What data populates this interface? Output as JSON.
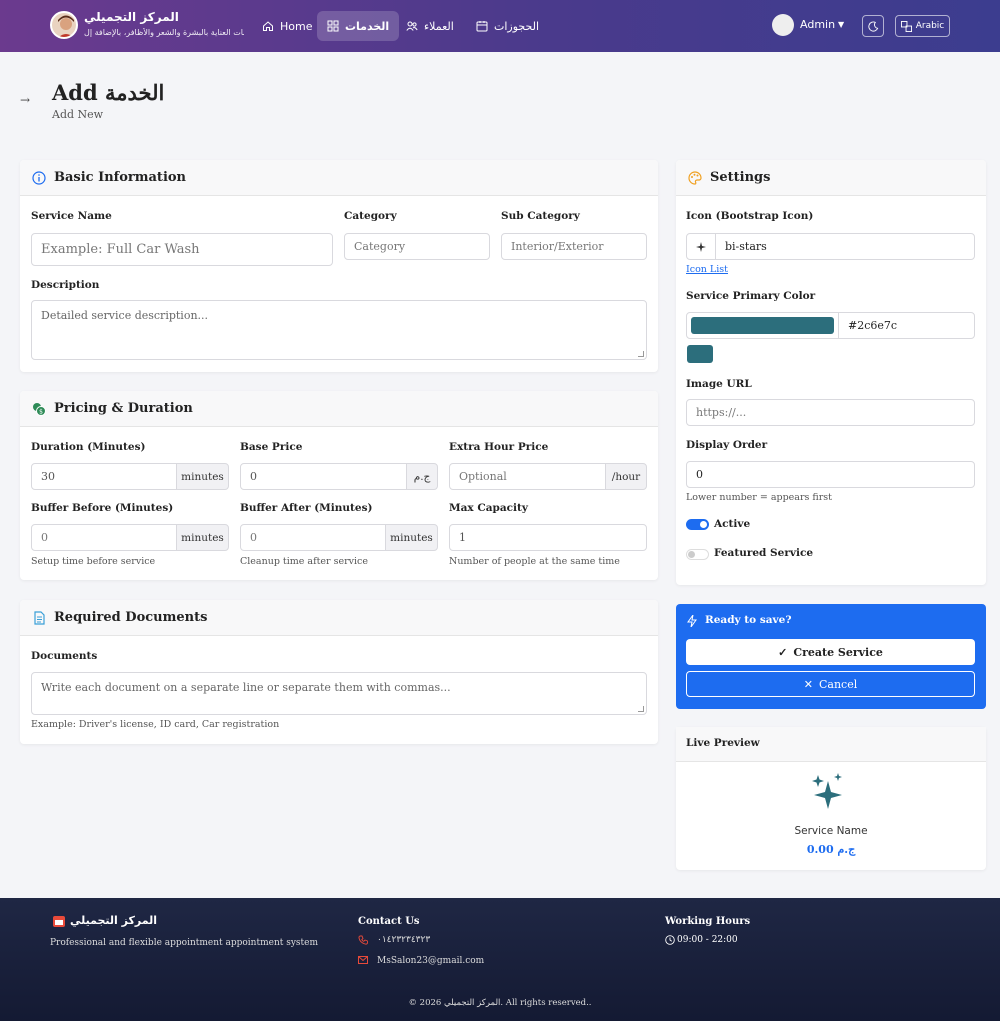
{
  "nav": {
    "brand_name": "المركز التجميلي",
    "brand_sub": "خدمات العناية بالبشرة والشعر والأظافر، بالإضافة إل...",
    "items": [
      {
        "label": "Home",
        "icon": "home-icon"
      },
      {
        "label": "الخدمات",
        "icon": "grid-icon",
        "active": true
      },
      {
        "label": "العملاء",
        "icon": "users-icon"
      },
      {
        "label": "الحجوزات",
        "icon": "calendar-icon"
      }
    ],
    "user": "Admin",
    "lang": "Arabic"
  },
  "page": {
    "title": "Add الخدمة",
    "subtitle": "Add New"
  },
  "basic": {
    "title": "Basic Information",
    "service_name_label": "Service Name",
    "service_name_placeholder": "Example: Full Car Wash",
    "category_label": "Category",
    "category_placeholder": "Category",
    "subcategory_label": "Sub Category",
    "subcategory_placeholder": "Interior/Exterior",
    "description_label": "Description",
    "description_placeholder": "Detailed service description..."
  },
  "pricing": {
    "title": "Pricing & Duration",
    "duration_label": "Duration (Minutes)",
    "duration_value": "30",
    "duration_unit": "minutes",
    "base_price_label": "Base Price",
    "base_price_value": "0",
    "currency": "ج.م",
    "extra_label": "Extra Hour Price",
    "extra_placeholder": "Optional",
    "extra_unit": "/hour",
    "buffer_before_label": "Buffer Before (Minutes)",
    "buffer_before_placeholder": "0",
    "buffer_before_unit": "minutes",
    "buffer_before_hint": "Setup time before service",
    "buffer_after_label": "Buffer After (Minutes)",
    "buffer_after_placeholder": "0",
    "buffer_after_unit": "minutes",
    "buffer_after_hint": "Cleanup time after service",
    "capacity_label": "Max Capacity",
    "capacity_value": "1",
    "capacity_hint": "Number of people at the same time"
  },
  "documents": {
    "title": "Required Documents",
    "label": "Documents",
    "placeholder": "Write each document on a separate line or separate them with commas...",
    "hint": "Example: Driver's license, ID card, Car registration"
  },
  "settings": {
    "title": "Settings",
    "icon_label": "Icon (Bootstrap Icon)",
    "icon_value": "bi-stars",
    "icon_list_link": "Icon List",
    "color_label": "Service Primary Color",
    "color_value": "#2c6e7c",
    "image_label": "Image URL",
    "image_placeholder": "https://...",
    "order_label": "Display Order",
    "order_value": "0",
    "order_hint": "Lower number = appears first",
    "active_label": "Active",
    "active": true,
    "featured_label": "Featured Service",
    "featured": false
  },
  "save": {
    "title": "Ready to save?",
    "create": "Create Service",
    "cancel": "Cancel"
  },
  "preview": {
    "title": "Live Preview",
    "name": "Service Name",
    "price": "0.00 ج.م"
  },
  "footer": {
    "brand": "المركز التجميلي",
    "tagline": "Professional and flexible appointment appointment system",
    "contact_title": "Contact Us",
    "phone": "٠١٤٢٣٢٣٤٣٢٣",
    "email": "MsSalon23@gmail.com",
    "hours_title": "Working Hours",
    "hours": "09:00 - 22:00",
    "copyright": "© 2026 المركز التجميلي. All rights reserved.."
  },
  "colors": {
    "primary": "#1d6cf0",
    "service": "#2c6e7c",
    "nav_start": "#6b3a8e",
    "nav_end": "#3c3d8f"
  }
}
